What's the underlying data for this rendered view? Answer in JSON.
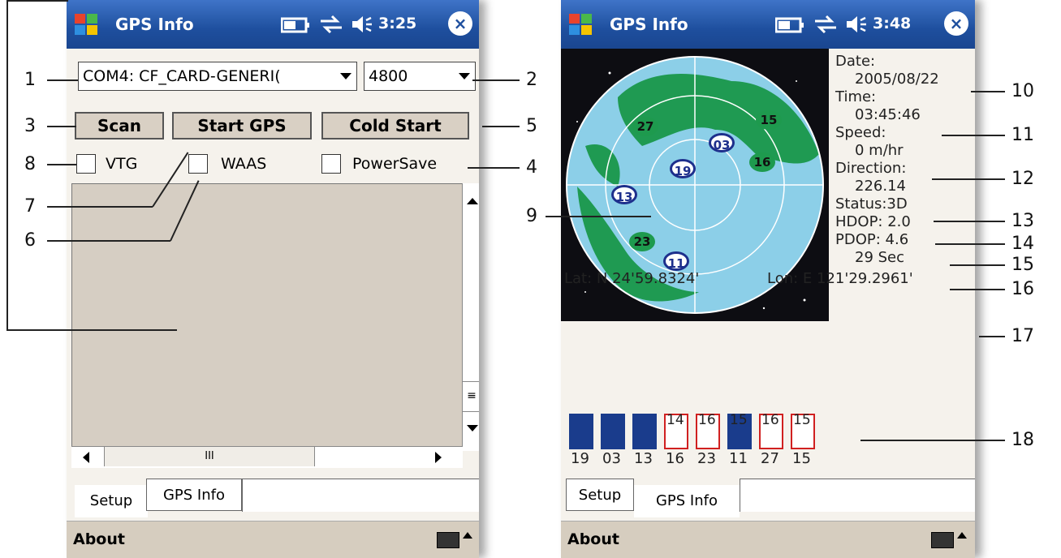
{
  "left": {
    "app_title": "GPS Info",
    "clock": "3:25",
    "close_glyph": "×",
    "com_port": "COM4:  CF_CARD-GENERI(",
    "baud": "4800",
    "scan_label": "Scan",
    "start_label": "Start GPS",
    "cold_label": "Cold Start",
    "vtg_label": "VTG",
    "waas_label": "WAAS",
    "powersave_label": "PowerSave",
    "hscroll_thumb": "III",
    "tab_setup": "Setup",
    "tab_gps": "GPS Info",
    "menu_about": "About"
  },
  "right": {
    "app_title": "GPS Info",
    "clock": "3:48",
    "close_glyph": "×",
    "date_label": "Date:",
    "date_value": "2005/08/22",
    "time_label": "Time:",
    "time_value": "03:45:46",
    "speed_label": "Speed:",
    "speed_value": "0 m/hr",
    "direction_label": "Direction:",
    "direction_value": "226.14",
    "status": "Status:3D",
    "hdop": "HDOP: 2.0",
    "pdop": "PDOP: 4.6",
    "age": "29 Sec",
    "lat": "Lat: N  24'59.8324'",
    "lon": "Lon: E  121'29.2961'",
    "satellites": [
      {
        "id": "27",
        "kind": "green"
      },
      {
        "id": "15",
        "kind": "green"
      },
      {
        "id": "03",
        "kind": "blue"
      },
      {
        "id": "16",
        "kind": "green"
      },
      {
        "id": "19",
        "kind": "blue"
      },
      {
        "id": "13",
        "kind": "blue"
      },
      {
        "id": "23",
        "kind": "green"
      },
      {
        "id": "11",
        "kind": "blue"
      }
    ],
    "signal_bars": [
      {
        "id": "19",
        "top_label": "",
        "filled": true
      },
      {
        "id": "03",
        "top_label": "",
        "filled": true
      },
      {
        "id": "13",
        "top_label": "",
        "filled": true
      },
      {
        "id": "16",
        "top_label": "14",
        "filled": false
      },
      {
        "id": "23",
        "top_label": "16",
        "filled": false
      },
      {
        "id": "11",
        "top_label": "15",
        "filled": true
      },
      {
        "id": "27",
        "top_label": "16",
        "filled": false
      },
      {
        "id": "15",
        "top_label": "15",
        "filled": false
      }
    ],
    "tab_setup": "Setup",
    "tab_gps": "GPS Info",
    "menu_about": "About"
  },
  "callouts": {
    "c1": "1",
    "c2": "2",
    "c3": "3",
    "c4": "4",
    "c5": "5",
    "c6": "6",
    "c7": "7",
    "c8": "8",
    "c9": "9",
    "c10": "10",
    "c11": "11",
    "c12": "12",
    "c13": "13",
    "c14": "14",
    "c15": "15",
    "c16": "16",
    "c17": "17",
    "c18": "18"
  },
  "colors": {
    "titlebar": "#1e4f9e",
    "sat_blue": "#1d2f8c",
    "sat_green": "#1e9a4e",
    "bar_filled": "#1a3c8c",
    "bar_empty": "#d02020"
  }
}
